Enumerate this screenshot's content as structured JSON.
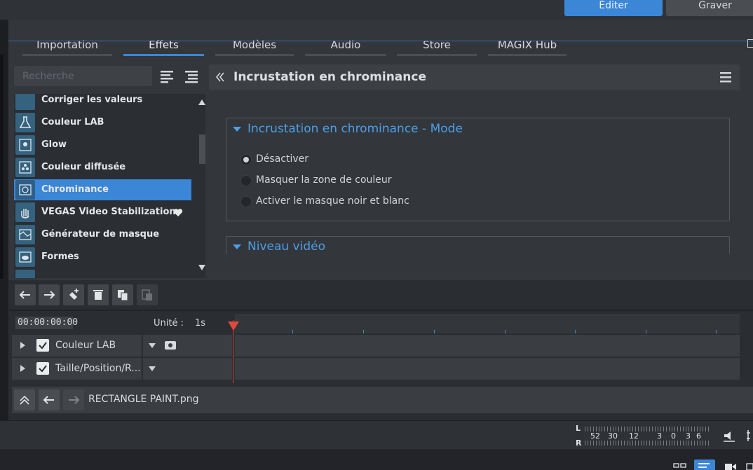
{
  "modes": {
    "edit": "Éditer",
    "burn": "Graver"
  },
  "tabs": [
    "Importation",
    "Effets",
    "Modèles",
    "Audio",
    "Store",
    "MAGIX Hub"
  ],
  "search": {
    "placeholder": "Recherche"
  },
  "effects_list": [
    "Corriger les valeurs",
    "Couleur LAB",
    "Glow",
    "Couleur diffusée",
    "Chrominance",
    "VEGAS Video Stabilization",
    "Générateur de masque",
    "Formes"
  ],
  "selected_effect": "Chrominance",
  "panel": {
    "title": "Incrustation en chrominance",
    "mode_group": {
      "title": "Incrustation en chrominance - Mode",
      "options": [
        "Désactiver",
        "Masquer la zone de couleur",
        "Activer le masque noir et blanc"
      ],
      "selected": "Désactiver"
    },
    "level_group": {
      "title": "Niveau vidéo"
    }
  },
  "timeline": {
    "timecode": "00:00:00:00",
    "unit_label": "Unité :",
    "unit_value": "1s",
    "tracks": [
      "Couleur LAB",
      "Taille/Position/R..."
    ],
    "file": "RECTANGLE PAINT.png"
  },
  "meter": {
    "left": "L",
    "right": "R",
    "scale": [
      "52",
      "30",
      "12",
      "3",
      "0",
      "3",
      "6"
    ]
  },
  "colors": {
    "accent": "#3b86d6",
    "playhead": "#e04a3d",
    "group_title": "#4c9ee6"
  }
}
